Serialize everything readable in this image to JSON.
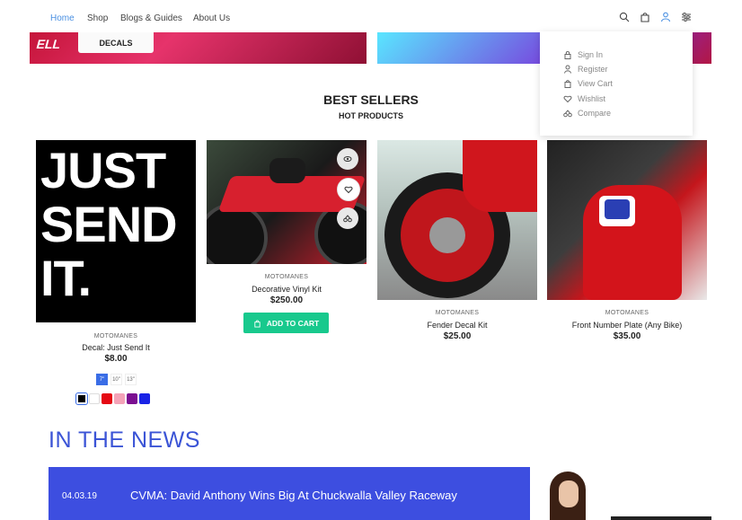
{
  "nav": {
    "items": [
      "Home",
      "Shop",
      "Blogs & Guides",
      "About Us"
    ]
  },
  "icons": [
    "search-icon",
    "bag-icon",
    "user-icon",
    "settings-sliders-icon"
  ],
  "banner": {
    "button_label": "DECALS",
    "partial_text": "ELL"
  },
  "account_menu": {
    "items": [
      {
        "label": "Sign In",
        "icon": "lock-icon"
      },
      {
        "label": "Register",
        "icon": "user-icon"
      },
      {
        "label": "View Cart",
        "icon": "bag-icon"
      },
      {
        "label": "Wishlist",
        "icon": "heart-icon"
      },
      {
        "label": "Compare",
        "icon": "compare-icon"
      }
    ]
  },
  "section": {
    "title": "BEST SELLERS",
    "subtitle": "HOT PRODUCTS"
  },
  "products": [
    {
      "brand": "MOTOMANES",
      "name": "Decal: Just Send It",
      "price": "$8.00",
      "image_text": [
        "JUST",
        "SEND",
        "IT."
      ]
    },
    {
      "brand": "MOTOMANES",
      "name": "Decorative Vinyl Kit",
      "price": "$250.00"
    },
    {
      "brand": "MOTOMANES",
      "name": "Fender Decal Kit",
      "price": "$25.00"
    },
    {
      "brand": "MOTOMANES",
      "name": "Front Number Plate (Any Bike)",
      "price": "$35.00"
    }
  ],
  "cart_button": {
    "label": "ADD TO CART"
  },
  "sizes": [
    "7\"",
    "10\"",
    "13\""
  ],
  "swatch_colors": [
    "#000000",
    "#ffffff",
    "#e50914",
    "#f4a3b8",
    "#7b0f91",
    "#1a23e6"
  ],
  "news": {
    "title": "IN THE NEWS",
    "date": "04.03.19",
    "headline": "CVMA: David Anthony Wins Big At Chuckwalla Valley Raceway"
  },
  "colors": {
    "accent": "#4a90e2",
    "cart": "#18c98d",
    "news": "#3d4ee0"
  }
}
